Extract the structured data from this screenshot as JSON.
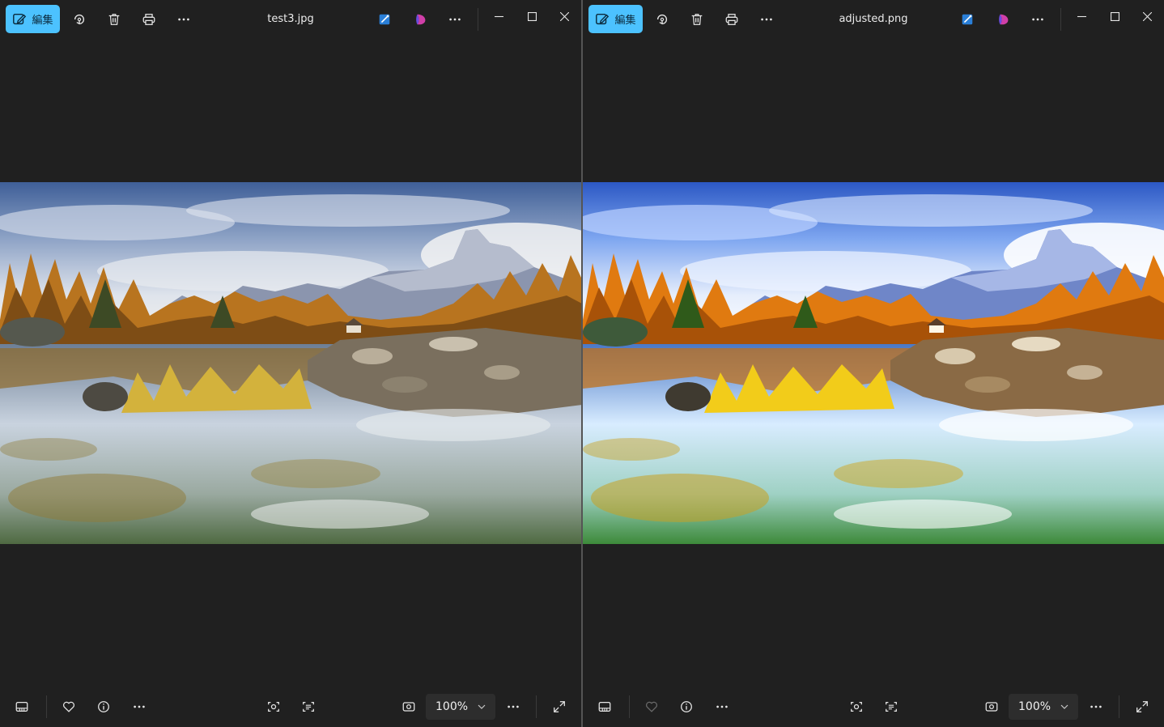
{
  "windows": [
    {
      "id": "left",
      "title": "test3.jpg",
      "edit_label": "編集",
      "zoom": "100%",
      "favorite_enabled": true,
      "adjusted": false
    },
    {
      "id": "right",
      "title": "adjusted.png",
      "edit_label": "編集",
      "zoom": "100%",
      "favorite_enabled": false,
      "adjusted": true
    }
  ],
  "colors": {
    "accent": "#4cc2ff",
    "background": "#202020",
    "icon": "#e6e6e6"
  },
  "icons": {
    "toolbar": [
      "edit-icon",
      "rotate-icon",
      "delete-icon",
      "print-icon",
      "more-icon",
      "enhance-icon",
      "copilot-icon",
      "more-icon"
    ],
    "caption": [
      "minimize-icon",
      "maximize-icon",
      "close-icon"
    ],
    "bottom": [
      "filmstrip-icon",
      "heart-icon",
      "info-icon",
      "more-icon",
      "visual-search-icon",
      "extract-text-icon",
      "actual-size-icon",
      "chevron-down-icon",
      "more-icon",
      "fullscreen-icon"
    ]
  }
}
